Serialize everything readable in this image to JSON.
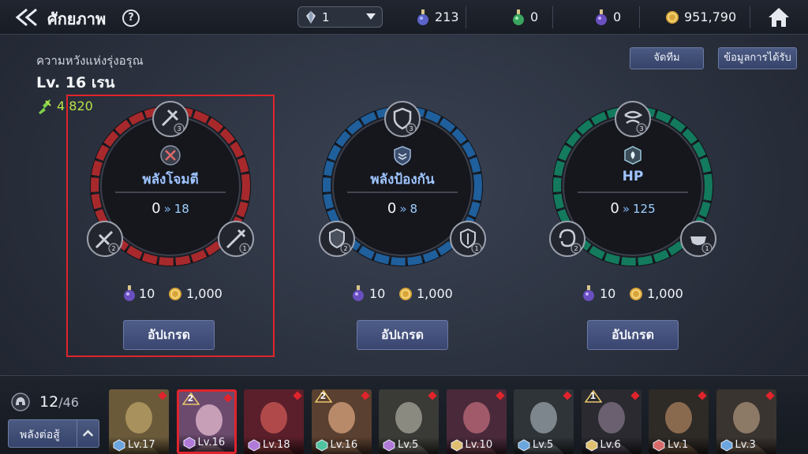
{
  "header": {
    "title": "ศักยภาพ",
    "help": "?",
    "selector_value": "1",
    "resources": [
      {
        "icon": "blue-potion-icon",
        "value": "213"
      },
      {
        "icon": "green-potion-icon",
        "value": "0"
      },
      {
        "icon": "purple-potion-icon",
        "value": "0"
      },
      {
        "icon": "gold-coin-icon",
        "value": "951,790"
      }
    ]
  },
  "hero": {
    "subtitle": "ความหวังแห่งรุ่งอรุณ",
    "level": "Lv. 16 เรน",
    "power": "4 820"
  },
  "buttons": {
    "team": "จัดทีม",
    "info": "ข้อมูลการได้รับ",
    "upgrade": "อัปเกรด"
  },
  "potentials": [
    {
      "name": "พลังโจมตี",
      "current": "0",
      "next": "18",
      "cost_potion": "10",
      "cost_gold": "1,000",
      "color": "#a8292c",
      "icon": "attack-icon"
    },
    {
      "name": "พลังป้องกัน",
      "current": "0",
      "next": "8",
      "cost_potion": "10",
      "cost_gold": "1,000",
      "color": "#1f5f9c",
      "icon": "defense-icon"
    },
    {
      "name": "HP",
      "current": "0",
      "next": "125",
      "cost_potion": "10",
      "cost_gold": "1,000",
      "color": "#137a5e",
      "icon": "hp-icon"
    }
  ],
  "node_ranks": [
    "3",
    "2",
    "1"
  ],
  "team": {
    "current": "12",
    "total": "/46",
    "fight_label": "พลังต่อสู้"
  },
  "heroes": [
    {
      "level": "Lv.17",
      "rank": "",
      "class": "#6ba6de"
    },
    {
      "level": "Lv.16",
      "rank": "2",
      "class": "#b27ad8",
      "selected": true
    },
    {
      "level": "Lv.18",
      "rank": "",
      "class": "#b27ad8"
    },
    {
      "level": "Lv.16",
      "rank": "2",
      "class": "#4fc2a0"
    },
    {
      "level": "Lv.5",
      "rank": "",
      "class": "#b27ad8"
    },
    {
      "level": "Lv.10",
      "rank": "",
      "class": "#e0c070"
    },
    {
      "level": "Lv.5",
      "rank": "",
      "class": "#6ba6de"
    },
    {
      "level": "Lv.6",
      "rank": "1",
      "class": "#e0c070"
    },
    {
      "level": "Lv.1",
      "rank": "",
      "class": "#d86a6a"
    },
    {
      "level": "Lv.3",
      "rank": "",
      "class": "#6ba6de"
    }
  ],
  "colors": {
    "accent": "#e0242c",
    "power": "#b8e34a",
    "button": "#3a4670"
  }
}
